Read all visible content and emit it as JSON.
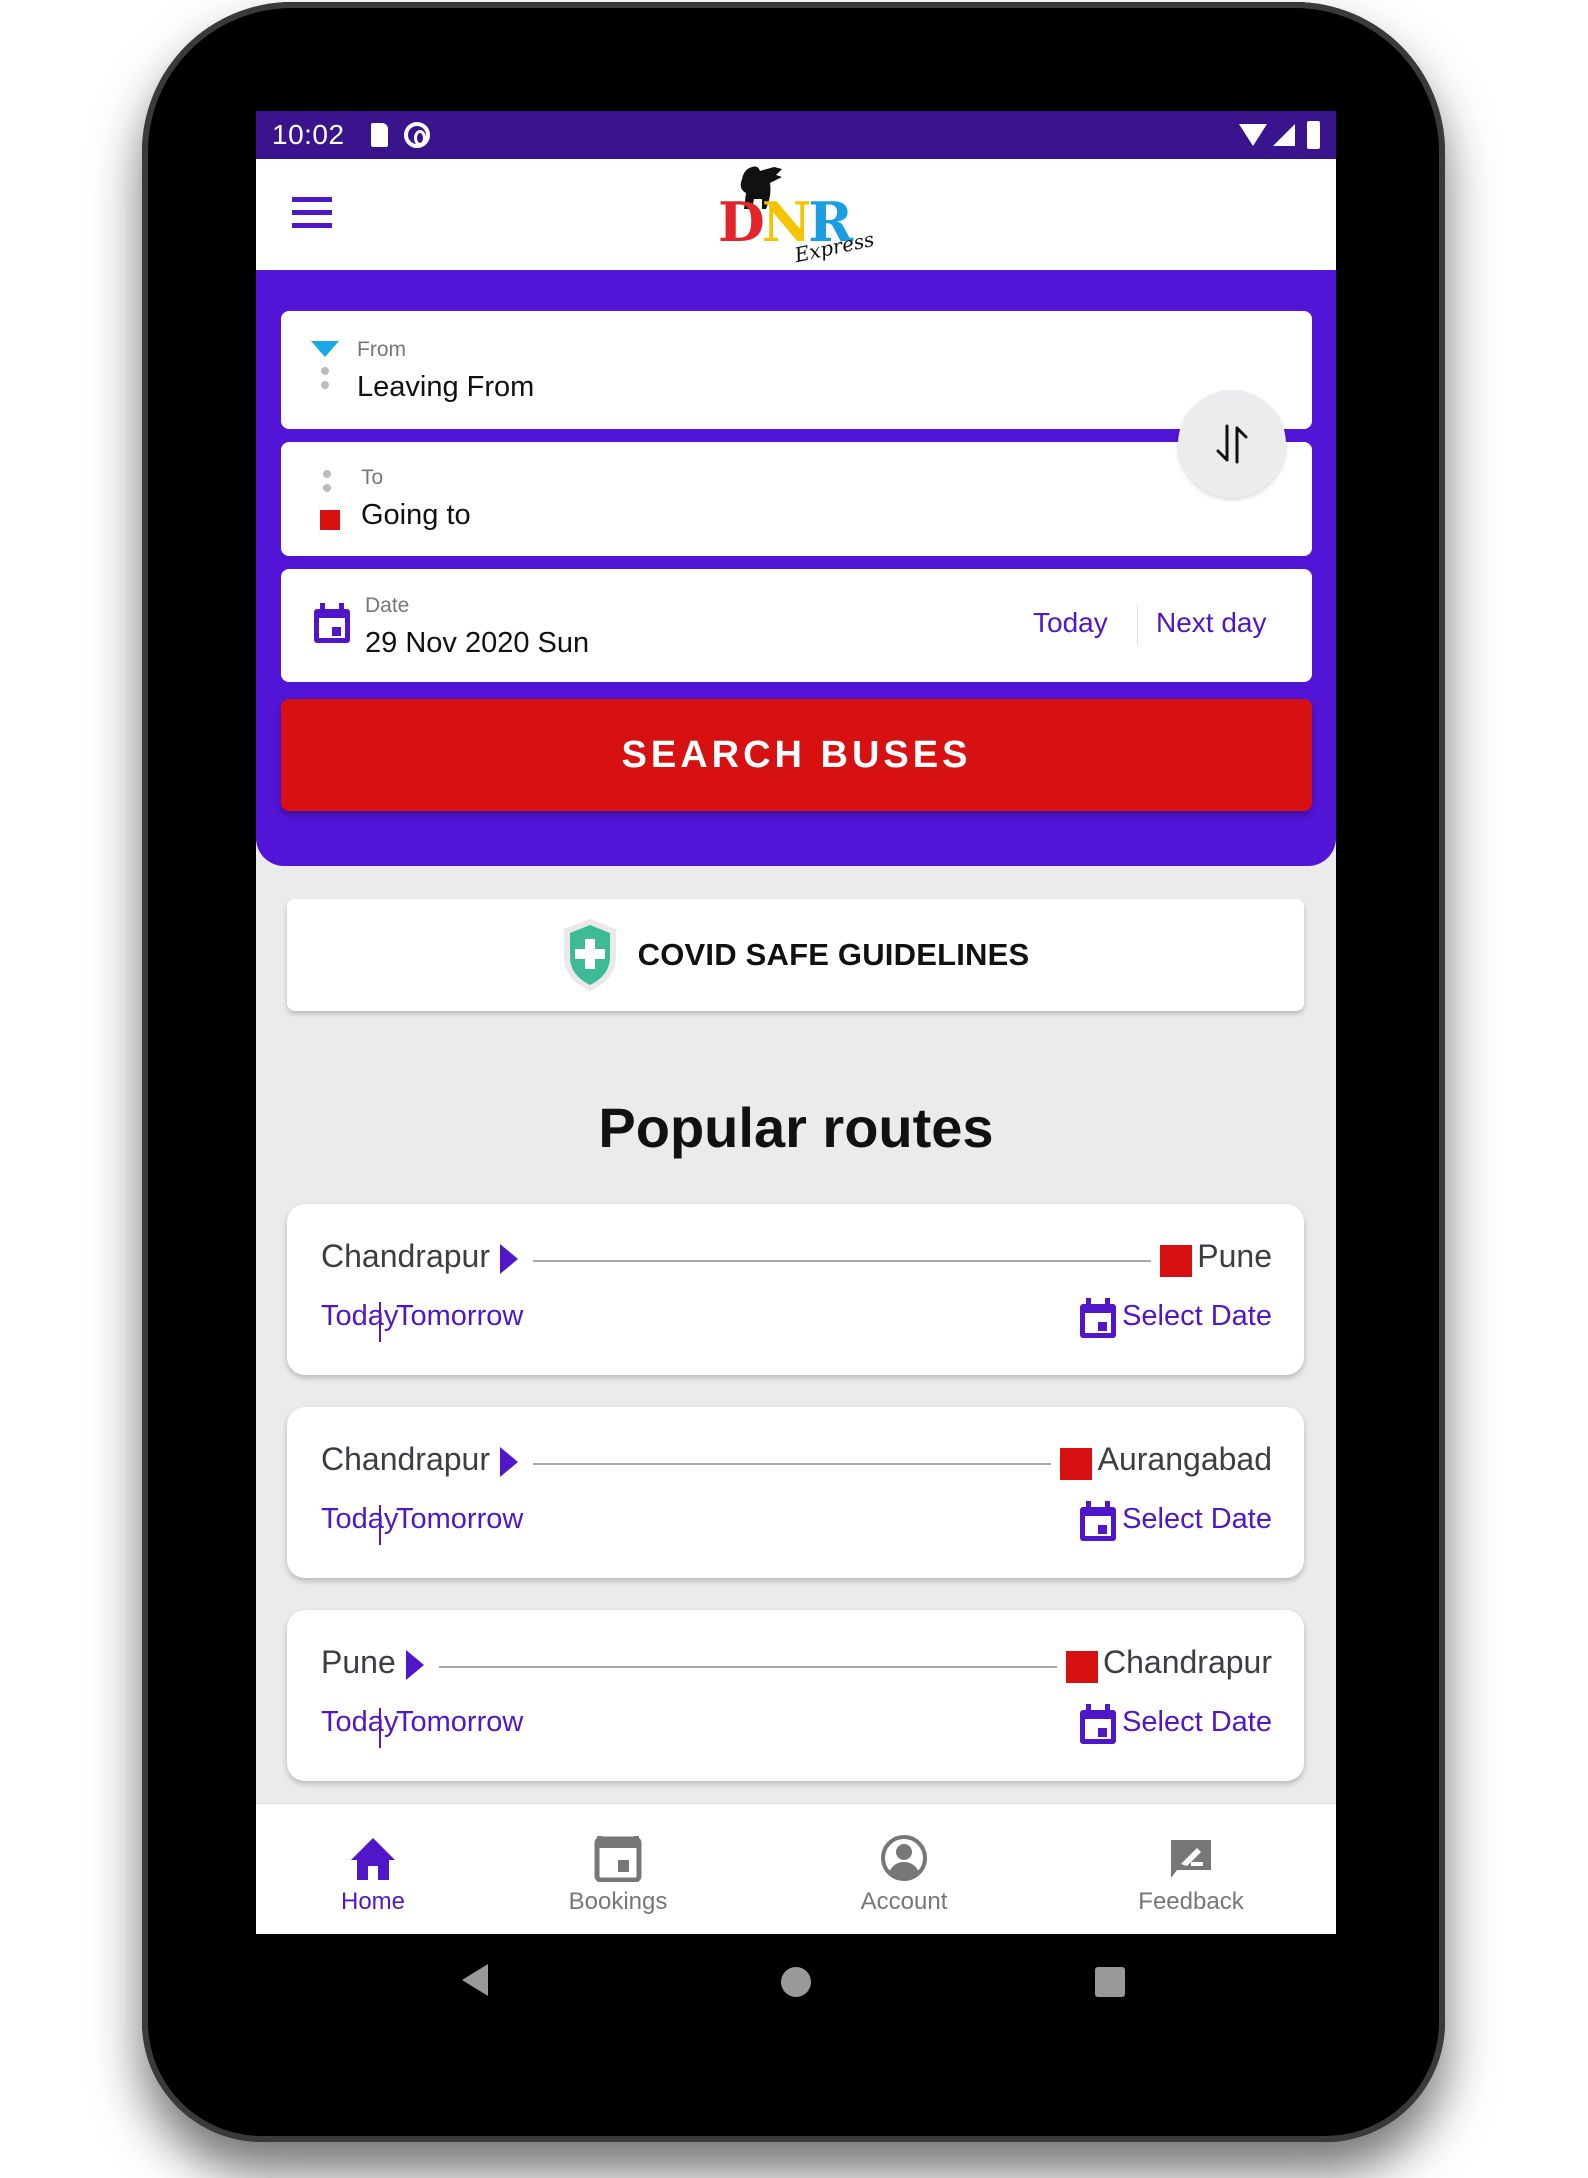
{
  "status_bar": {
    "time": "10:02",
    "left_icons": [
      "sd-card-icon",
      "data-saver-icon"
    ],
    "right_icons": [
      "wifi-icon",
      "cell-signal-icon",
      "battery-icon"
    ]
  },
  "app_bar": {
    "menu_icon": "hamburger-menu-icon",
    "logo": {
      "letters": [
        "D",
        "N",
        "R"
      ],
      "subtitle": "Express"
    }
  },
  "search": {
    "from": {
      "label": "From",
      "value": "Leaving From"
    },
    "to": {
      "label": "To",
      "value": "Going to"
    },
    "swap_icon": "swap-vertical-icon",
    "date": {
      "label": "Date",
      "value": "29 Nov 2020 Sun",
      "today_label": "Today",
      "next_day_label": "Next day"
    },
    "search_button": "SEARCH BUSES"
  },
  "covid": {
    "label": "COVID SAFE GUIDELINES",
    "icon": "shield-plus-icon"
  },
  "popular_routes": {
    "title": "Popular routes",
    "routes": [
      {
        "from": "Chandrapur",
        "to": "Pune",
        "today": "Today",
        "tomorrow": "Tomorrow",
        "select_date": "Select Date"
      },
      {
        "from": "Chandrapur",
        "to": "Aurangabad",
        "today": "Today",
        "tomorrow": "Tomorrow",
        "select_date": "Select Date"
      },
      {
        "from": "Pune",
        "to": "Chandrapur",
        "today": "Today",
        "tomorrow": "Tomorrow",
        "select_date": "Select Date"
      }
    ]
  },
  "bottom_nav": {
    "items": [
      {
        "label": "Home",
        "icon": "home-icon",
        "active": true
      },
      {
        "label": "Bookings",
        "icon": "calendar-icon",
        "active": false
      },
      {
        "label": "Account",
        "icon": "account-circle-icon",
        "active": false
      },
      {
        "label": "Feedback",
        "icon": "feedback-icon",
        "active": false
      }
    ]
  },
  "colors": {
    "primary": "#5214d6",
    "status_bar": "#3a148c",
    "accent_red": "#d71111",
    "from_marker": "#1aa8e6",
    "covid_green": "#3dbb97",
    "inactive_nav": "#777777"
  }
}
